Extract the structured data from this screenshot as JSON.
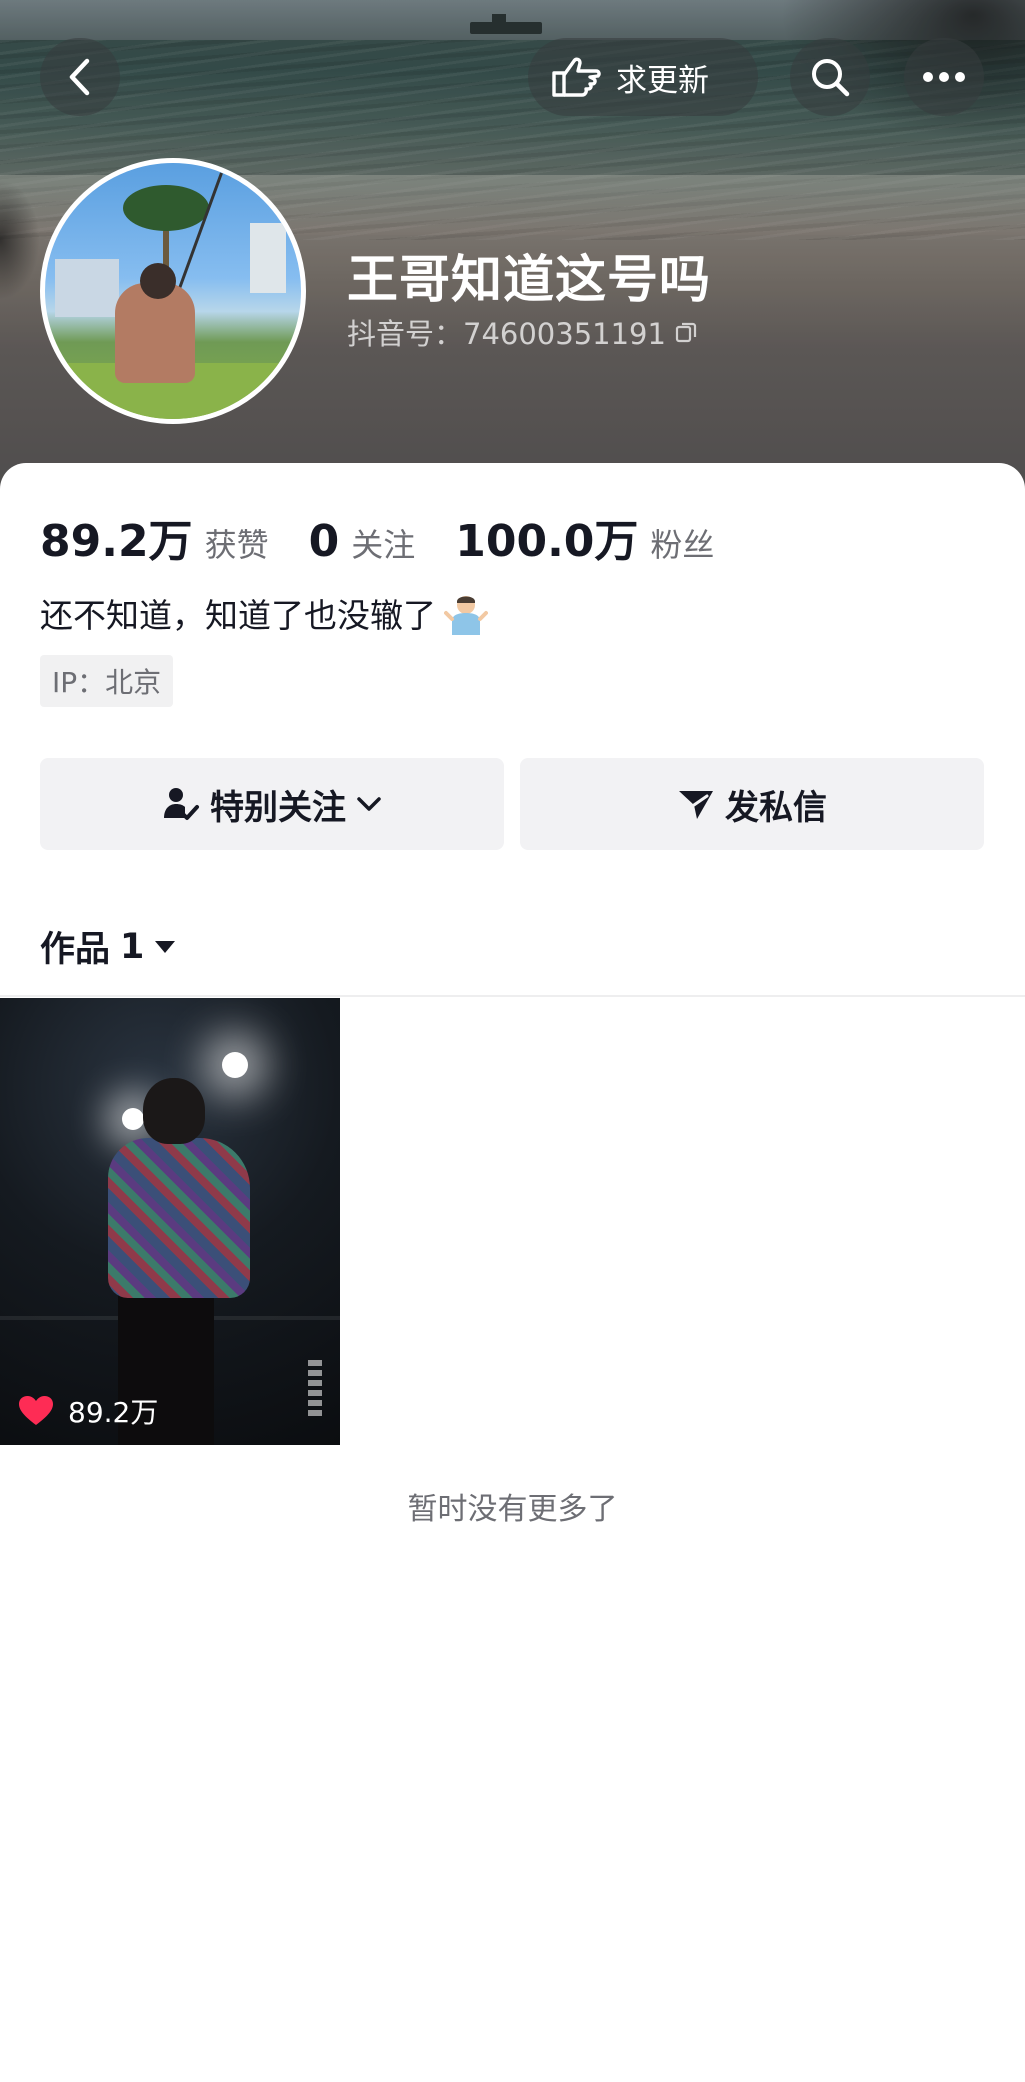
{
  "header": {
    "request_update_label": "求更新",
    "username": "王哥知道这号吗",
    "account_id": "抖音号：74600351191"
  },
  "stats": {
    "likes_value": "89.2万",
    "likes_label": "获赞",
    "following_value": "0",
    "following_label": "关注",
    "followers_value": "100.0万",
    "followers_label": "粉丝"
  },
  "profile": {
    "bio": "还不知道，知道了也没辙了",
    "ip_location": "IP：北京"
  },
  "actions": {
    "special_follow_label": "特别关注",
    "message_label": "发私信"
  },
  "works": {
    "tab_label": "作品",
    "count": "1",
    "items": [
      {
        "likes": "89.2万"
      }
    ],
    "end_text": "暂时没有更多了"
  },
  "icons": {
    "back": "chevron-left-icon",
    "request": "pointing-hand-icon",
    "search": "search-icon",
    "more": "more-dots-icon",
    "copy": "copy-icon",
    "follow": "user-check-icon",
    "message": "paper-plane-icon",
    "dropdown": "caret-down-icon",
    "like": "heart-icon"
  },
  "colors": {
    "like_red": "#fe2c55",
    "text_primary": "#161823",
    "text_secondary": "#6d6e74",
    "button_bg": "#f2f2f4"
  }
}
